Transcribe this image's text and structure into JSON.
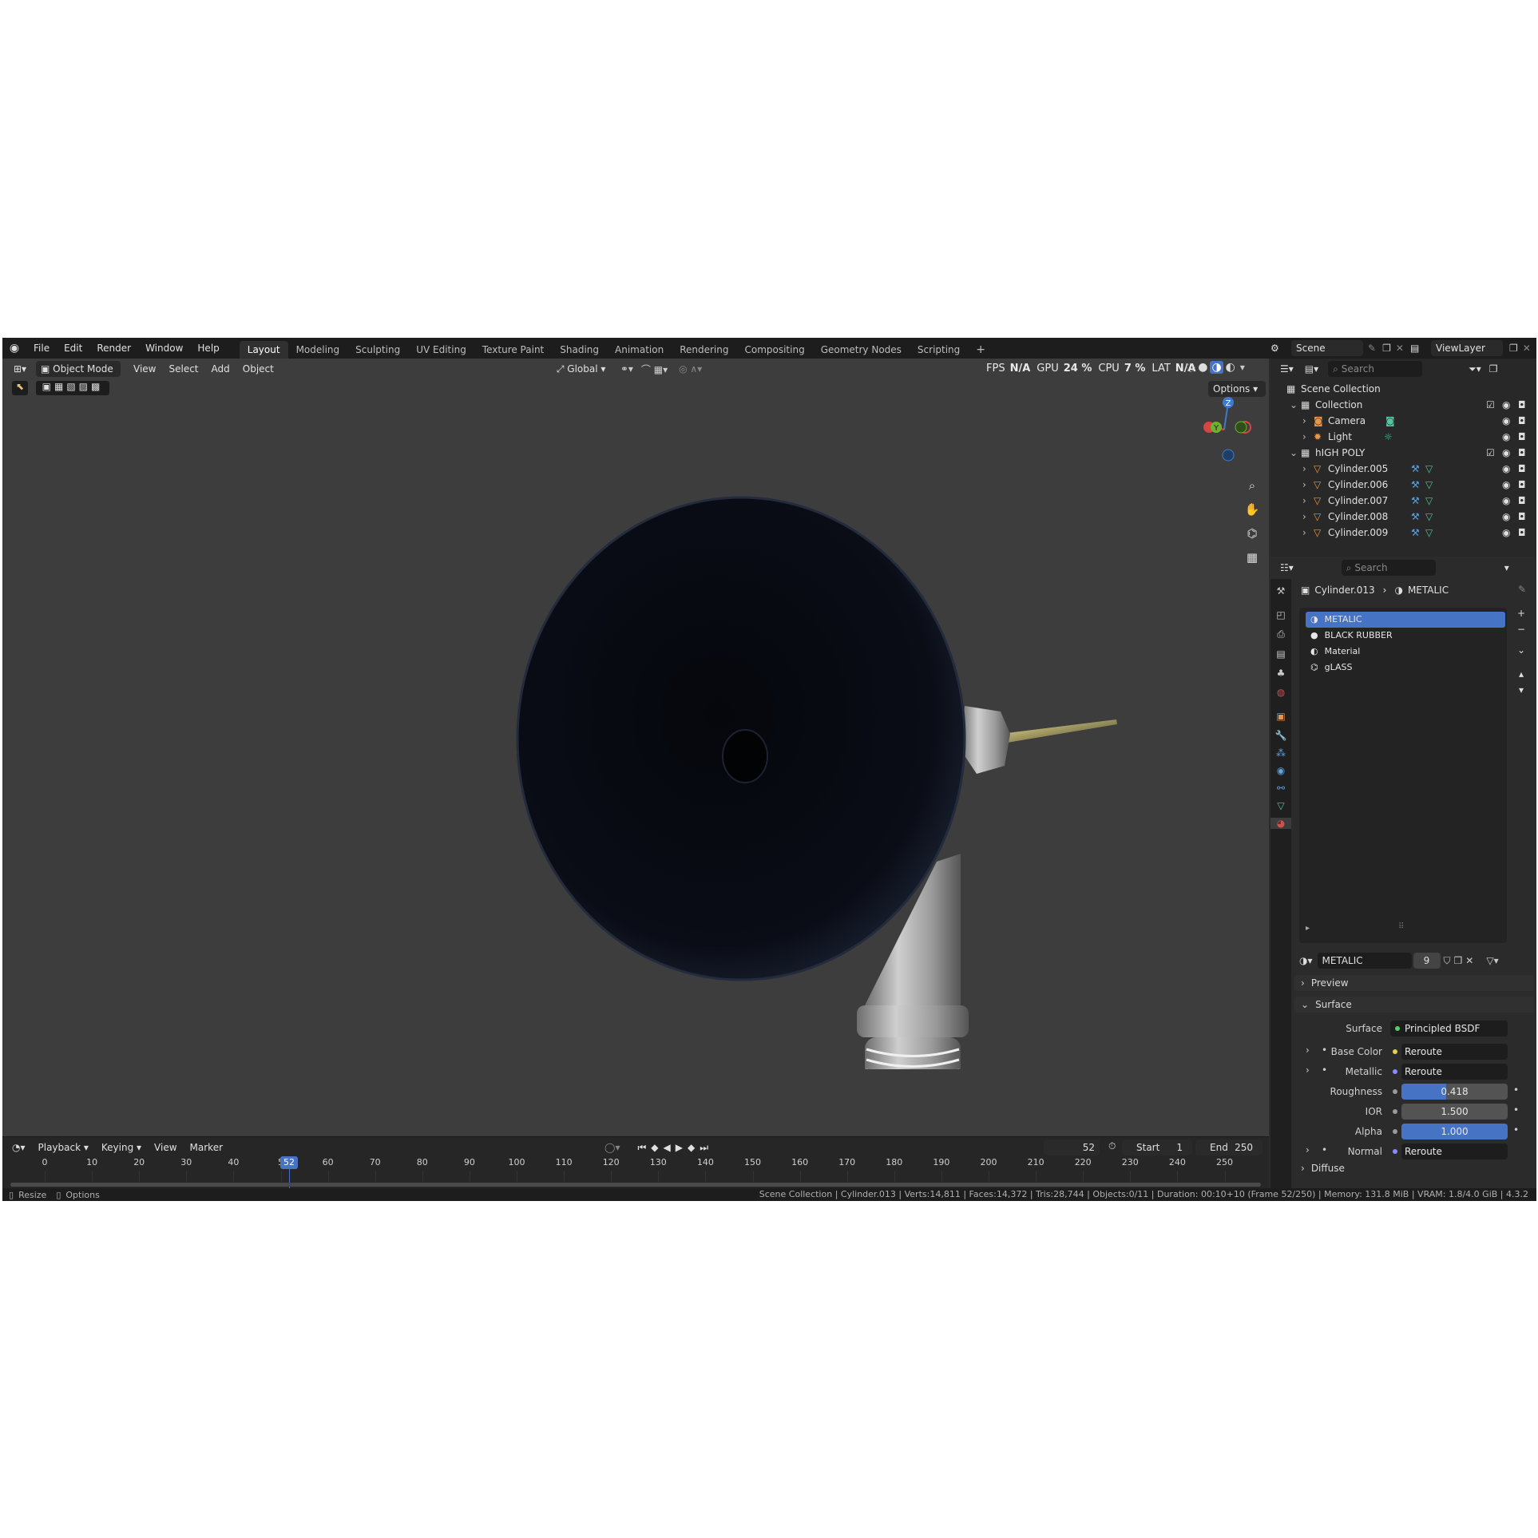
{
  "colors": {
    "accent": "#4673c4",
    "viewport_bg": "#3d3d3d",
    "panel_bg": "#2b2b2b",
    "header_bg": "#1d1d1d",
    "selection": "#4673c4",
    "mesh_icon": "#e9964a",
    "data_icon": "#52c5a0"
  },
  "menu": [
    "File",
    "Edit",
    "Render",
    "Window",
    "Help"
  ],
  "workspaces": {
    "active": "Layout",
    "tabs": [
      "Modeling",
      "Sculpting",
      "UV Editing",
      "Texture Paint",
      "Shading",
      "Animation",
      "Rendering",
      "Compositing",
      "Geometry Nodes",
      "Scripting"
    ],
    "add": "+"
  },
  "topright": {
    "scene": "Scene",
    "viewlayer": "ViewLayer"
  },
  "viewport": {
    "mode": "Object Mode",
    "menus": [
      "View",
      "Select",
      "Add",
      "Object"
    ],
    "orientation": "Global",
    "options": "Options",
    "overlay_text": {
      "fps": "FPS",
      "fps_val": "N/A",
      "gpu": "GPU",
      "gpu_val": "24 %",
      "cpu": "CPU",
      "cpu_val": "7 %",
      "lat": "LAT",
      "lat_val": "N/A"
    },
    "gizmo": {
      "z": "Z",
      "y": "Y",
      "x": "X"
    }
  },
  "timeline": {
    "menus": [
      "Playback",
      "Keying",
      "View",
      "Marker"
    ],
    "current_frame": "52",
    "start_label": "Start",
    "start": "1",
    "end_label": "End",
    "end": "250",
    "ticks": [
      "0",
      "10",
      "20",
      "30",
      "40",
      "5",
      "60",
      "70",
      "80",
      "90",
      "100",
      "110",
      "120",
      "130",
      "140",
      "150",
      "160",
      "170",
      "180",
      "190",
      "200",
      "210",
      "220",
      "230",
      "240",
      "250"
    ],
    "playhead": "52"
  },
  "outliner": {
    "search_placeholder": "Search",
    "root": "Scene Collection",
    "items": [
      {
        "label": "Collection",
        "type": "collection",
        "level": 0
      },
      {
        "label": "Camera",
        "type": "camera",
        "level": 1
      },
      {
        "label": "Light",
        "type": "light",
        "level": 1
      },
      {
        "label": "hIGH POLY",
        "type": "collection",
        "level": 0
      },
      {
        "label": "Cylinder.005",
        "type": "mesh",
        "level": 1
      },
      {
        "label": "Cylinder.006",
        "type": "mesh",
        "level": 1
      },
      {
        "label": "Cylinder.007",
        "type": "mesh",
        "level": 1
      },
      {
        "label": "Cylinder.008",
        "type": "mesh",
        "level": 1
      },
      {
        "label": "Cylinder.009",
        "type": "mesh",
        "level": 1
      }
    ]
  },
  "properties": {
    "search_placeholder": "Search",
    "breadcrumb_object": "Cylinder.013",
    "breadcrumb_material": "METALIC",
    "slots": [
      "METALIC",
      "BLACK RUBBER",
      "Material",
      "gLASS"
    ],
    "material_name": "METALIC",
    "user_count": "9",
    "sections": {
      "preview": "Preview",
      "surface": "Surface",
      "diffuse": "Diffuse"
    },
    "surface_label": "Surface",
    "surface_value": "Principled BSDF",
    "fields": [
      {
        "label": "Base Color",
        "value": "Reroute",
        "kind": "link"
      },
      {
        "label": "Metallic",
        "value": "Reroute",
        "kind": "link"
      },
      {
        "label": "Roughness",
        "value": "0.418",
        "kind": "slider",
        "fill": 0.418
      },
      {
        "label": "IOR",
        "value": "1.500",
        "kind": "slider",
        "fill": 0
      },
      {
        "label": "Alpha",
        "value": "1.000",
        "kind": "slider",
        "fill": 1.0
      },
      {
        "label": "Normal",
        "value": "Reroute",
        "kind": "link"
      }
    ]
  },
  "status": {
    "left1": "Resize",
    "left2": "Options",
    "right": "Scene Collection | Cylinder.013 | Verts:14,811 | Faces:14,372 | Tris:28,744 | Objects:0/11 | Duration: 00:10+10 (Frame 52/250) | Memory: 131.8 MiB | VRAM: 1.8/4.0 GiB | 4.3.2"
  }
}
